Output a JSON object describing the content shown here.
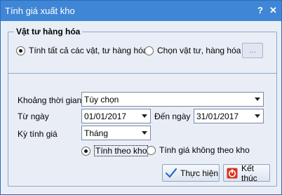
{
  "window": {
    "title": "Tính giá xuất kho",
    "help_label": "?",
    "close_label": "✕"
  },
  "group1": {
    "legend": "Vật tư hàng hóa",
    "option_all": "Tính tất cả các vật, tư hàng hóa",
    "option_select": "Chọn vật tư, hàng hóa",
    "browse_label": "...",
    "selected": "option_all"
  },
  "group2": {
    "period_label": "Khoảng thời gian",
    "period_value": "Tùy chọn",
    "from_label": "Từ ngày",
    "from_value": "01/01/2017",
    "to_label": "Đến ngày",
    "to_value": "31/01/2017",
    "cycle_label": "Kỳ tính giá",
    "cycle_value": "Tháng",
    "by_warehouse": "Tính theo kho",
    "not_by_warehouse": "Tính giá không theo kho",
    "selected": "by_warehouse"
  },
  "buttons": {
    "run_label": "Thực hiện",
    "exit_label": "Kết thúc"
  }
}
